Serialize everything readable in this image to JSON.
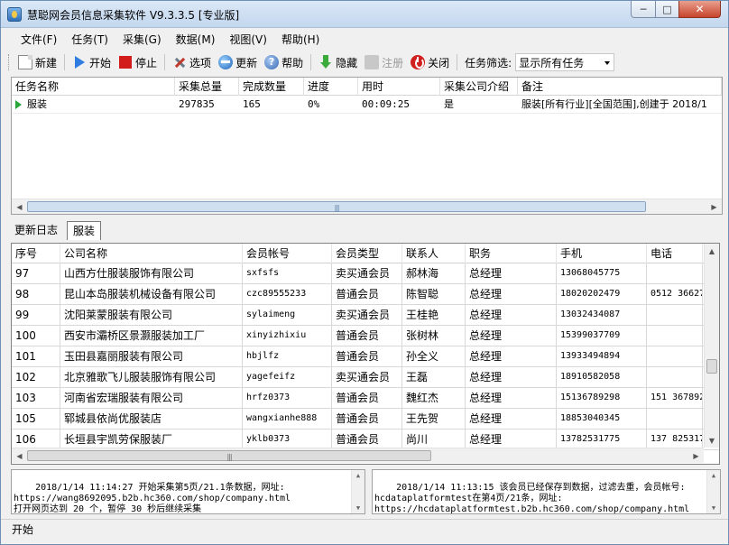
{
  "window": {
    "title": "慧聪网会员信息采集软件 V9.3.3.5 [专业版]",
    "min_glyph": "─",
    "max_glyph": "□",
    "close_glyph": "✕"
  },
  "menu": [
    {
      "label": "文件(F)"
    },
    {
      "label": "任务(T)"
    },
    {
      "label": "采集(G)"
    },
    {
      "label": "数据(M)"
    },
    {
      "label": "视图(V)"
    },
    {
      "label": "帮助(H)"
    }
  ],
  "toolbar": {
    "new": "新建",
    "start": "开始",
    "stop": "停止",
    "options": "选项",
    "update": "更新",
    "help": "帮助",
    "hide": "隐藏",
    "register": "注册",
    "close": "关闭",
    "filter_label": "任务筛选:",
    "filter_value": "显示所有任务"
  },
  "task_table": {
    "headers": [
      "任务名称",
      "采集总量",
      "完成数量",
      "进度",
      "用时",
      "采集公司介绍",
      "备注"
    ],
    "rows": [
      [
        "服装",
        "297835",
        "165",
        "0%",
        "00:09:25",
        "是",
        "服装[所有行业][全国范围],创建于 2018/1"
      ]
    ]
  },
  "scroll": {
    "grip": "|||",
    "left": "◀",
    "right": "▶",
    "up": "▲",
    "down": "▼"
  },
  "tabs": [
    "更新日志",
    "服装"
  ],
  "member_table": {
    "headers": [
      "序号",
      "公司名称",
      "会员帐号",
      "会员类型",
      "联系人",
      "职务",
      "手机",
      "电话"
    ],
    "rows": [
      [
        "97",
        "山西方仕服装服饰有限公司",
        "sxfsfs",
        "卖买通会员",
        "郝林海",
        "总经理",
        "13068045775",
        ""
      ],
      [
        "98",
        "昆山本岛服装机械设备有限公司",
        "czc89555233",
        "普通会员",
        "陈智聪",
        "总经理",
        "18020202479",
        "0512 36627"
      ],
      [
        "99",
        "沈阳莱蒙服装有限公司",
        "sylaimeng",
        "卖买通会员",
        "王桂艳",
        "总经理",
        "13032434087",
        ""
      ],
      [
        "100",
        "西安市灞桥区景灏服装加工厂",
        "xinyizhixiu",
        "普通会员",
        "张树林",
        "总经理",
        "15399037709",
        ""
      ],
      [
        "101",
        "玉田县嘉丽服装有限公司",
        "hbjlfz",
        "普通会员",
        "孙全义",
        "总经理",
        "13933494894",
        ""
      ],
      [
        "102",
        "北京雅歌飞儿服装服饰有限公司",
        "yagefeifz",
        "卖买通会员",
        "王磊",
        "总经理",
        "18910582058",
        ""
      ],
      [
        "103",
        "河南省宏瑞服装有限公司",
        "hrfz0373",
        "普通会员",
        "魏红杰",
        "总经理",
        "15136789298",
        "151 367892"
      ],
      [
        "105",
        "郓城县依尚优服装店",
        "wangxianhe888",
        "普通会员",
        "王先贺",
        "总经理",
        "18853040345",
        ""
      ],
      [
        "106",
        "长垣县宇凯劳保服装厂",
        "yklb0373",
        "普通会员",
        "尚川",
        "总经理",
        "13782531775",
        "137 825317"
      ]
    ]
  },
  "logs": {
    "left": "2018/1/14 11:14:27 开始采集第5页/21.1条数据，网址: https://wang8692095.b2b.hc360.com/shop/company.html\n打开网页达到 20 个，暂停 30 秒后继续采集",
    "right": "2018/1/14 11:13:15 该会员已经保存到数据，过滤去重，会员帐号: hcdataplatformtest在第4页/21条，网址: https://hcdataplatformtest.b2b.hc360.com/shop/company.html"
  },
  "status": {
    "text": "开始"
  }
}
